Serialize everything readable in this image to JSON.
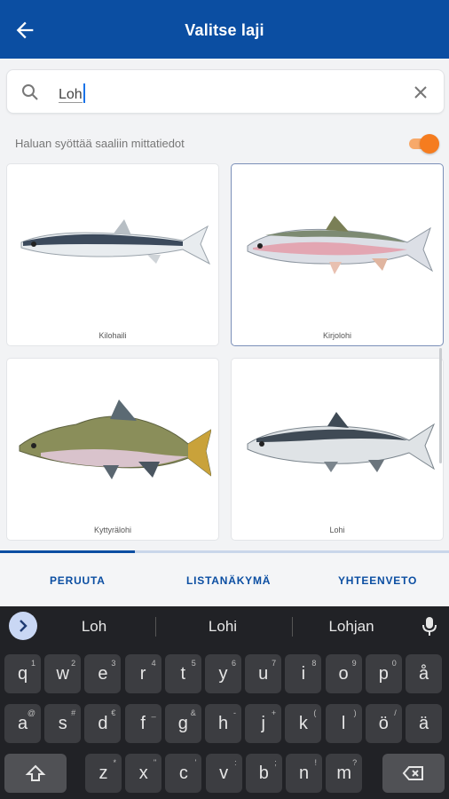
{
  "appbar": {
    "title": "Valitse laji"
  },
  "search": {
    "query": "Loh"
  },
  "toggle": {
    "label": "Haluan syöttää saaliin mittatiedot",
    "on": true,
    "color": "#f57c1f"
  },
  "species": [
    {
      "name": "Kilohaili",
      "selected": false
    },
    {
      "name": "Kirjolohi",
      "selected": true
    },
    {
      "name": "Kyttyrälohi",
      "selected": false
    },
    {
      "name": "Lohi",
      "selected": false
    }
  ],
  "actions": {
    "cancel": "PERUUTA",
    "list_view": "LISTANÄKYMÄ",
    "summary": "YHTEENVETO"
  },
  "keyboard": {
    "suggestions": [
      "Loh",
      "Lohi",
      "Lohjan"
    ],
    "row1": [
      {
        "k": "q",
        "a": "1"
      },
      {
        "k": "w",
        "a": "2"
      },
      {
        "k": "e",
        "a": "3"
      },
      {
        "k": "r",
        "a": "4"
      },
      {
        "k": "t",
        "a": "5"
      },
      {
        "k": "y",
        "a": "6"
      },
      {
        "k": "u",
        "a": "7"
      },
      {
        "k": "i",
        "a": "8"
      },
      {
        "k": "o",
        "a": "9"
      },
      {
        "k": "p",
        "a": "0"
      },
      {
        "k": "å",
        "a": ""
      }
    ],
    "row2": [
      {
        "k": "a",
        "a": "@"
      },
      {
        "k": "s",
        "a": "#"
      },
      {
        "k": "d",
        "a": "€"
      },
      {
        "k": "f",
        "a": "_"
      },
      {
        "k": "g",
        "a": "&"
      },
      {
        "k": "h",
        "a": "-"
      },
      {
        "k": "j",
        "a": "+"
      },
      {
        "k": "k",
        "a": "("
      },
      {
        "k": "l",
        "a": ")"
      },
      {
        "k": "ö",
        "a": "/"
      },
      {
        "k": "ä",
        "a": ""
      }
    ],
    "row3": [
      {
        "k": "z",
        "a": "*"
      },
      {
        "k": "x",
        "a": "\""
      },
      {
        "k": "c",
        "a": "'"
      },
      {
        "k": "v",
        "a": ":"
      },
      {
        "k": "b",
        "a": ";"
      },
      {
        "k": "n",
        "a": "!"
      },
      {
        "k": "m",
        "a": "?"
      }
    ]
  },
  "colors": {
    "primary": "#0b4ea2",
    "accent": "#f57c1f"
  }
}
